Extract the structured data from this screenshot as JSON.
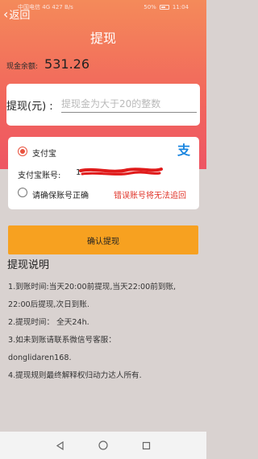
{
  "status": {
    "carrier": "中国电信",
    "signal": "4G",
    "speed": "427 B/s",
    "battery": "50%",
    "time": "11:04"
  },
  "header": {
    "back_label": "返回",
    "title": "提现"
  },
  "balance": {
    "label": "现金余额:",
    "value": "531.26"
  },
  "amount": {
    "label": "提现(元) :",
    "placeholder": "提现金为大于20的整数"
  },
  "payment": {
    "method_label": "支付宝",
    "account_label": "支付宝账号:",
    "account_value_visible": "1",
    "confirm_label": "请确保账号正确",
    "warning": "错误账号将无法追回",
    "icon": "alipay-icon",
    "accent": "#e8523e",
    "warning_color": "#e0362b"
  },
  "submit": {
    "label": "确认提现",
    "color": "#f7a120"
  },
  "explanation": {
    "title": "提现说明",
    "lines": [
      "1.到账时间:当天20:00前提现,当天22:00前到账,",
      "22:00后提现,次日到账.",
      "2.提现时间： 全天24h.",
      "3.如未到账请联系微信号客服：",
      "donglidaren168.",
      "4.提现规则最终解释权归动力达人所有."
    ]
  },
  "nav": {
    "back": "back-triangle-icon",
    "home": "home-circle-icon",
    "recents": "recents-square-icon"
  }
}
